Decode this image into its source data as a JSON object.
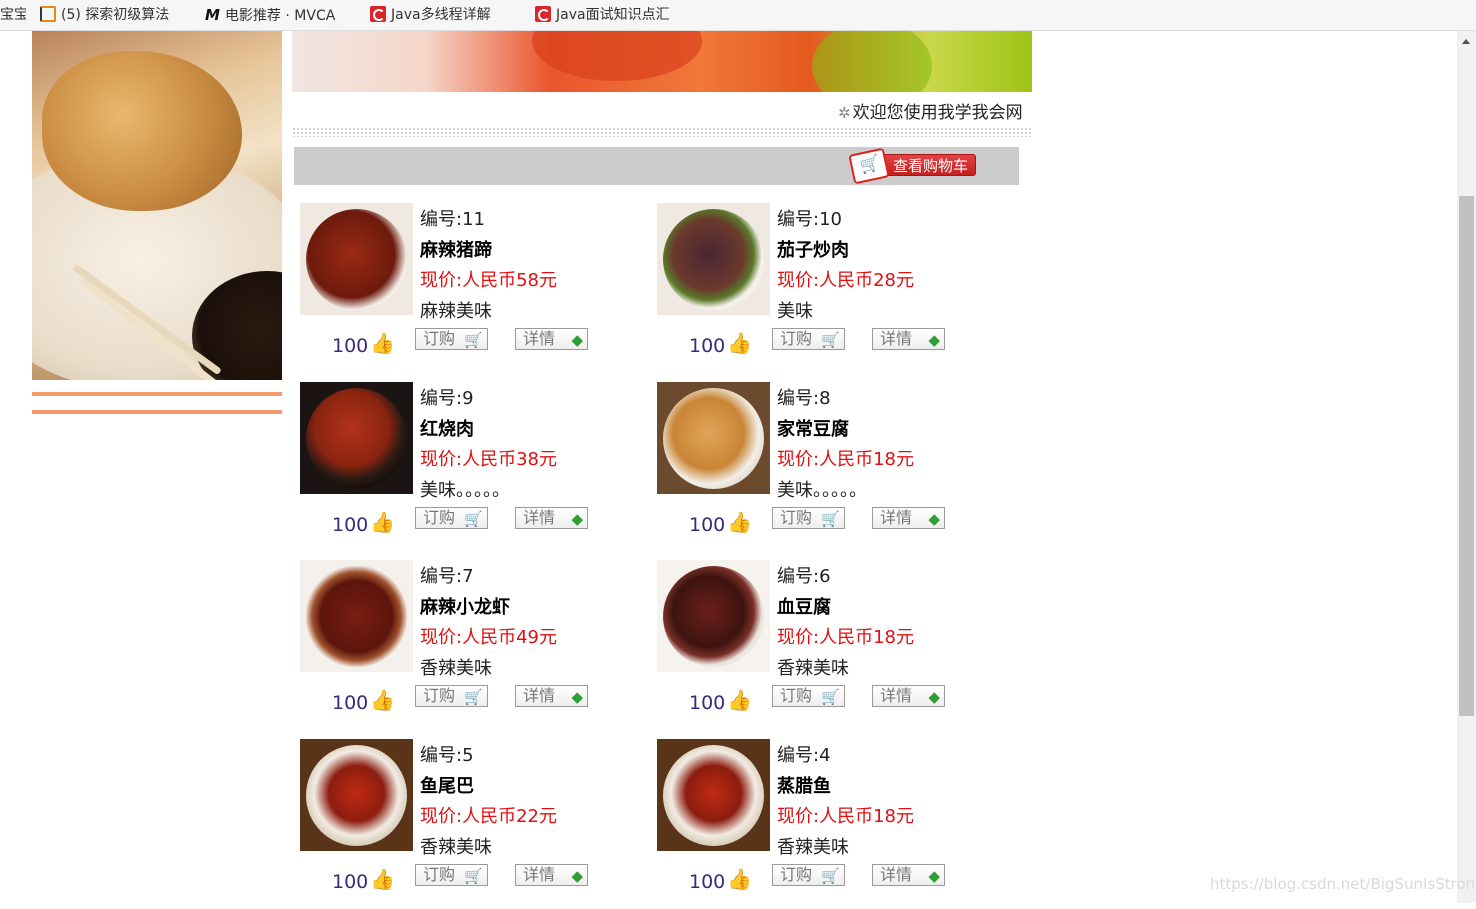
{
  "bookmarks": [
    {
      "label": "宝宝",
      "icon": "bookmark-icon"
    },
    {
      "label": "(5) 探索初级算法",
      "icon": "leetcode-icon"
    },
    {
      "label": "电影推荐 · MVCA",
      "icon": "m-logo-icon"
    },
    {
      "label": "Java多线程详解",
      "icon": "csdn-icon"
    },
    {
      "label": "Java面试知识点汇",
      "icon": "csdn-icon"
    }
  ],
  "header": {
    "welcome": "欢迎您使用我学我会网",
    "cart_button": "查看购物车"
  },
  "common": {
    "order_label": "订购",
    "detail_label": "详情"
  },
  "products": [
    {
      "no": "编号:11",
      "name": "麻辣猪蹄",
      "price": "现价:人民币58元",
      "desc": "麻辣美味",
      "likes": "100"
    },
    {
      "no": "编号:10",
      "name": "茄子炒肉",
      "price": "现价:人民币28元",
      "desc": "美味",
      "likes": "100"
    },
    {
      "no": "编号:9",
      "name": "红烧肉",
      "price": "现价:人民币38元",
      "desc": "美味。。。。。",
      "likes": "100"
    },
    {
      "no": "编号:8",
      "name": "家常豆腐",
      "price": "现价:人民币18元",
      "desc": "美味。。。。。",
      "likes": "100"
    },
    {
      "no": "编号:7",
      "name": "麻辣小龙虾",
      "price": "现价:人民币49元",
      "desc": "香辣美味",
      "likes": "100"
    },
    {
      "no": "编号:6",
      "name": "血豆腐",
      "price": "现价:人民币18元",
      "desc": "香辣美味",
      "likes": "100"
    },
    {
      "no": "编号:5",
      "name": "鱼尾巴",
      "price": "现价:人民币22元",
      "desc": "香辣美味",
      "likes": "100"
    },
    {
      "no": "编号:4",
      "name": "蒸腊鱼",
      "price": "现价:人民币18元",
      "desc": "香辣美味",
      "likes": "100"
    }
  ],
  "watermark": "https://blog.csdn.net/BigSunIsStrong",
  "colors": {
    "price": "#e01010",
    "likes": "#3a2a7a",
    "accent_line": "#f79b6a",
    "cart_bar": "#cccccc"
  }
}
